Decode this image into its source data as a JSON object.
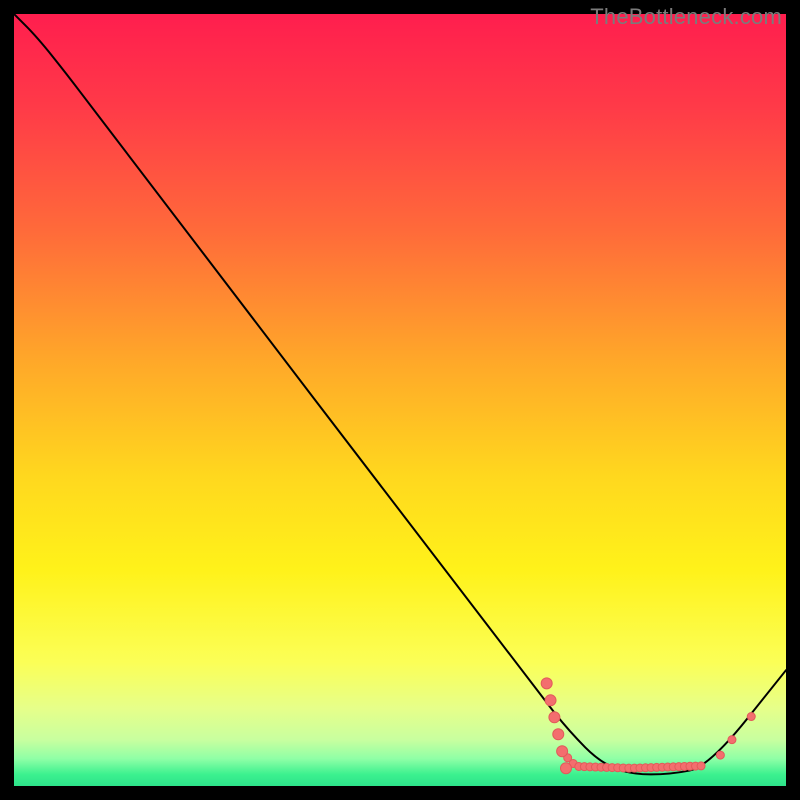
{
  "watermark": "TheBottleneck.com",
  "chart_data": {
    "type": "line",
    "title": "",
    "xlabel": "",
    "ylabel": "",
    "xlim": [
      0,
      100
    ],
    "ylim": [
      0,
      100
    ],
    "grid": false,
    "gradient_stops": [
      {
        "offset": 0.0,
        "color": "#ff1e4e"
      },
      {
        "offset": 0.12,
        "color": "#ff3a48"
      },
      {
        "offset": 0.28,
        "color": "#ff6a3a"
      },
      {
        "offset": 0.45,
        "color": "#ffa829"
      },
      {
        "offset": 0.6,
        "color": "#ffd81e"
      },
      {
        "offset": 0.72,
        "color": "#fff21a"
      },
      {
        "offset": 0.84,
        "color": "#fbff57"
      },
      {
        "offset": 0.9,
        "color": "#e6ff8a"
      },
      {
        "offset": 0.94,
        "color": "#c8ff9f"
      },
      {
        "offset": 0.965,
        "color": "#8effa6"
      },
      {
        "offset": 0.985,
        "color": "#3cf18f"
      },
      {
        "offset": 1.0,
        "color": "#2de28a"
      }
    ],
    "series": [
      {
        "name": "curve",
        "color": "#000000",
        "stroke_width": 2,
        "points": [
          {
            "x": 0.0,
            "y": 100.0
          },
          {
            "x": 3.0,
            "y": 97.0
          },
          {
            "x": 7.0,
            "y": 92.0
          },
          {
            "x": 10.0,
            "y": 88.0
          },
          {
            "x": 68.0,
            "y": 12.0
          },
          {
            "x": 72.0,
            "y": 7.0
          },
          {
            "x": 76.0,
            "y": 3.0
          },
          {
            "x": 80.0,
            "y": 1.5
          },
          {
            "x": 85.0,
            "y": 1.5
          },
          {
            "x": 90.0,
            "y": 2.5
          },
          {
            "x": 100.0,
            "y": 15.0
          }
        ]
      }
    ],
    "markers": {
      "color": "#f36e6e",
      "stroke": "#e25a5a",
      "cluster": {
        "start_x": 71,
        "end_x": 89,
        "y": 2.3,
        "count": 26,
        "radius": 4
      },
      "outliers": [
        {
          "x": 91.5,
          "y": 4.0,
          "r": 4
        },
        {
          "x": 93.0,
          "y": 6.0,
          "r": 4
        },
        {
          "x": 95.5,
          "y": 9.0,
          "r": 4
        }
      ]
    }
  }
}
